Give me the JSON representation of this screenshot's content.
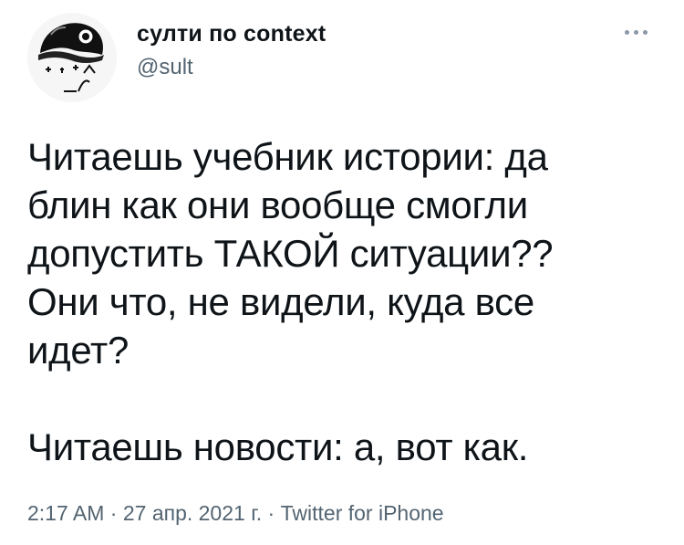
{
  "author": {
    "display_name": "султи по context",
    "handle": "@sult"
  },
  "more_icon": "more-horizontal-icon",
  "tweet": {
    "paragraph_1": "Читаешь учебник истории: да\nблин как они вообще смогли\nдопустить ТАКОЙ ситуации??\nОни что, не видели, куда все\nидет?",
    "paragraph_2": "Читаешь новости: а, вот как."
  },
  "meta": {
    "time": "2:17 AM",
    "separator_1": " · ",
    "date": "27 апр. 2021 г.",
    "separator_2": " · ",
    "source": "Twitter for iPhone"
  },
  "colors": {
    "text": "#0f1419",
    "secondary": "#536471",
    "background": "#ffffff"
  }
}
